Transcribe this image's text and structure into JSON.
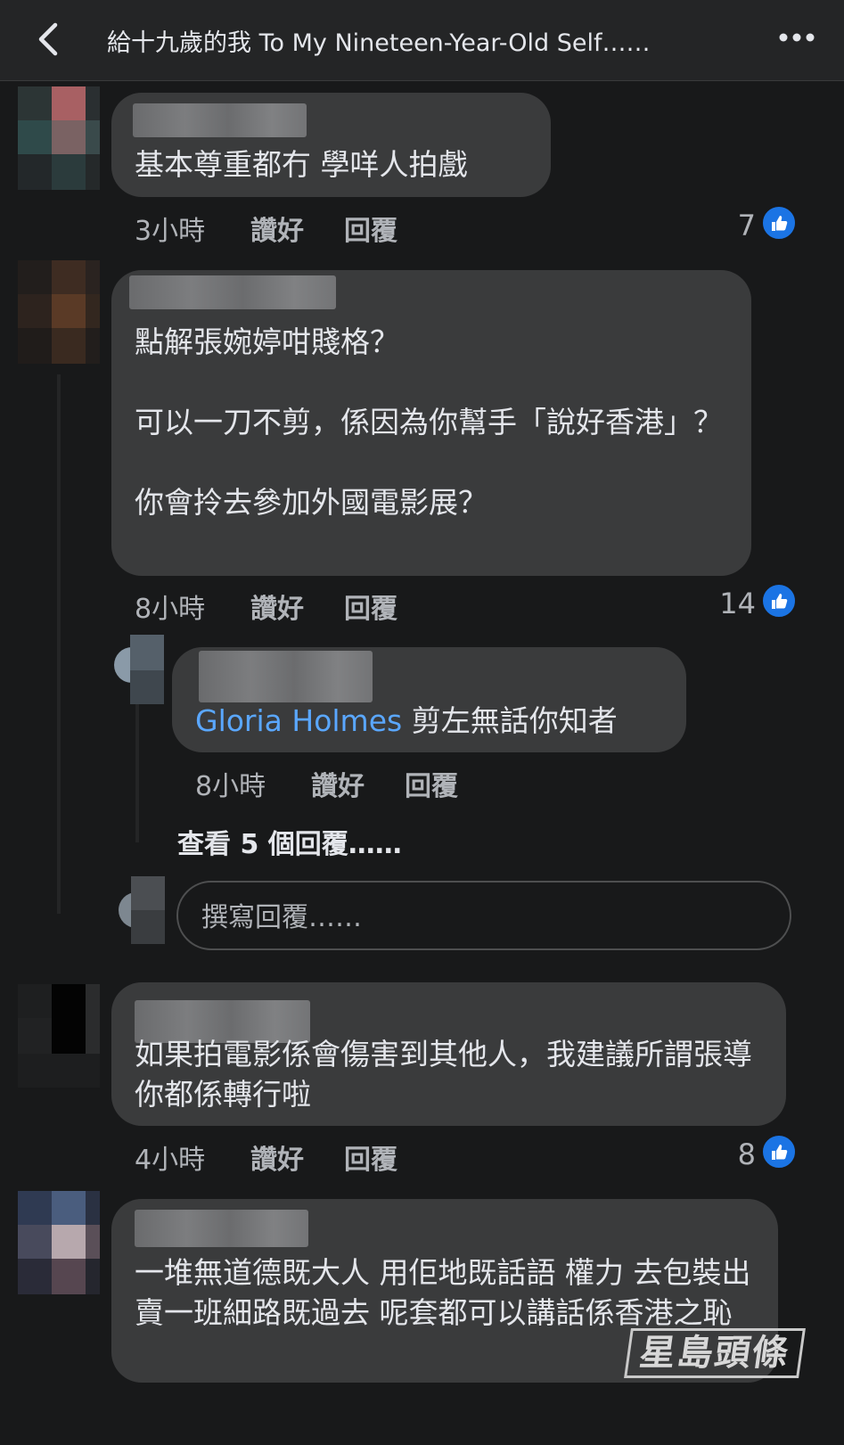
{
  "header": {
    "title": "給十九歲的我  To My Nineteen-Year-Old Self……",
    "back_icon": "chevron-left-icon",
    "more_icon": "more-dots-icon"
  },
  "actions": {
    "like": "讚好",
    "reply": "回覆"
  },
  "comments": [
    {
      "text": "基本尊重都冇 學咩人拍戲",
      "time": "3小時",
      "reactions": "7"
    },
    {
      "text": "點解張婉婷咁賤格？\n\n可以一刀不剪，係因為你幫手「說好香港」？\n\n你會拎去參加外國電影展？",
      "time": "8小時",
      "reactions": "14"
    },
    {
      "text": "如果拍電影係會傷害到其他人，我建議所謂張導你都係轉行啦",
      "time": "4小時",
      "reactions": "8"
    },
    {
      "text": "一堆無道德既大人 用佢地既話語 權力 去包裝出賣一班細路既過去 呢套都可以講話係香港之恥"
    }
  ],
  "reply": {
    "mention": "Gloria Holmes",
    "text": " 剪左無話你知者",
    "time": "8小時"
  },
  "view_more_replies": "查看 5 個回覆……",
  "reply_input": {
    "placeholder": "撰寫回覆……"
  },
  "watermark": "星島頭條",
  "colors": {
    "background": "#18191a",
    "bubble": "#3a3b3c",
    "accent": "#1b74e4",
    "mention": "#5aa7ff"
  }
}
